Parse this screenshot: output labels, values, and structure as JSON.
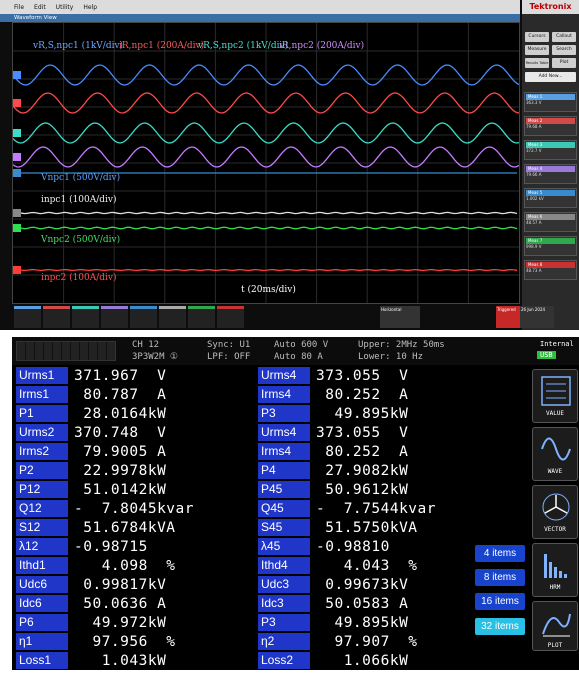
{
  "scope": {
    "menu": [
      "File",
      "Edit",
      "Utility",
      "Help"
    ],
    "brand": "Tektronix",
    "view_title": "Waveform View",
    "side_buttons": [
      "Cursors",
      "Callout",
      "Measure",
      "Search",
      "Results Table",
      "Plot",
      "Add New..."
    ],
    "meas_items": [
      {
        "title": "Meas 1",
        "value": "363.3 V",
        "color": "#5aa0e0"
      },
      {
        "title": "Meas 2",
        "value": "79.68 A",
        "color": "#d04a4a"
      },
      {
        "title": "Meas 3",
        "value": "372.7 V",
        "color": "#3cc8b4"
      },
      {
        "title": "Meas 4",
        "value": "79.66 A",
        "color": "#9a7ad8"
      },
      {
        "title": "Meas 5",
        "value": "1.002 kV",
        "color": "#3a8ad0"
      },
      {
        "title": "Meas 6",
        "value": "48.57 A",
        "color": "#888888"
      },
      {
        "title": "Meas 7",
        "value": "998.9 V",
        "color": "#2ea84a"
      },
      {
        "title": "Meas 8",
        "value": "48.73 A",
        "color": "#c83232"
      }
    ],
    "labels": {
      "vrs1": "vR,S,npc1 (1kV/div)",
      "ir1": "iR,npc1 (200A/div)",
      "vrs2": "vR,S,npc2 (1kV/div)",
      "ir2": "iR,npc2 (200A/div)",
      "vnpc1": "Vnpc1 (500V/div)",
      "inpc1": "inpc1 (100A/div)",
      "vnpc2": "Vnpc2 (500V/div)",
      "inpc2": "inpc2 (100A/div)",
      "time": "t (20ms/div)"
    },
    "bottom": {
      "timebase": "Horizontal",
      "trigger": "Triggered",
      "date": "26 Jun 2024"
    }
  },
  "meter": {
    "header": {
      "ch": "CH 12",
      "wiring": "3P3W2M ①",
      "sync": "Sync: U1",
      "lpf": "LPF: OFF",
      "range_v": "Auto 600 V",
      "range_a": "Auto  80 A",
      "upper": "Upper:  2MHz  50ms",
      "lower": "Lower: 10 Hz",
      "internal": "Internal",
      "usb": "USB"
    },
    "left": [
      {
        "label": "Urms1",
        "value": "371.967  V"
      },
      {
        "label": "Irms1",
        "value": " 80.787  A"
      },
      {
        "label": "P1",
        "value": " 28.0164kW"
      },
      {
        "label": "Urms2",
        "value": "370.748  V"
      },
      {
        "label": "Irms2",
        "value": " 79.9005 A"
      },
      {
        "label": "P2",
        "value": " 22.9978kW"
      },
      {
        "label": "P12",
        "value": " 51.0142kW"
      },
      {
        "label": "Q12",
        "value": "-  7.8045kvar"
      },
      {
        "label": "S12",
        "value": " 51.6784kVA"
      },
      {
        "label": "λ12",
        "value": "-0.98715"
      },
      {
        "label": "Ithd1",
        "value": "   4.098  %"
      },
      {
        "label": "Udc6",
        "value": " 0.99817kV"
      },
      {
        "label": "Idc6",
        "value": " 50.0636 A"
      },
      {
        "label": "P6",
        "value": "  49.972kW"
      },
      {
        "label": "η1",
        "value": "  97.956  %"
      },
      {
        "label": "Loss1",
        "value": "   1.043kW"
      }
    ],
    "right": [
      {
        "label": "Urms4",
        "value": "373.055  V"
      },
      {
        "label": "Irms4",
        "value": " 80.252  A"
      },
      {
        "label": "P3",
        "value": "  49.895kW"
      },
      {
        "label": "Urms4",
        "value": "373.055  V"
      },
      {
        "label": "Irms4",
        "value": " 80.252  A"
      },
      {
        "label": "P4",
        "value": " 27.9082kW"
      },
      {
        "label": "P45",
        "value": " 50.9612kW"
      },
      {
        "label": "Q45",
        "value": "-  7.7544kvar"
      },
      {
        "label": "S45",
        "value": " 51.5750kVA"
      },
      {
        "label": "λ45",
        "value": "-0.98810"
      },
      {
        "label": "Ithd4",
        "value": "   4.043  %"
      },
      {
        "label": "Udc3",
        "value": " 0.99673kV"
      },
      {
        "label": "Idc3",
        "value": " 50.0583 A"
      },
      {
        "label": "P3",
        "value": "  49.895kW"
      },
      {
        "label": "η2",
        "value": "  97.907  %"
      },
      {
        "label": "Loss2",
        "value": "   1.066kW"
      }
    ],
    "side_buttons": [
      "VALUE",
      "WAVE",
      "VECTOR",
      "HRM",
      "PLOT"
    ],
    "item_buttons": [
      "4 items",
      "8 items",
      "16 items",
      "32 items"
    ]
  }
}
